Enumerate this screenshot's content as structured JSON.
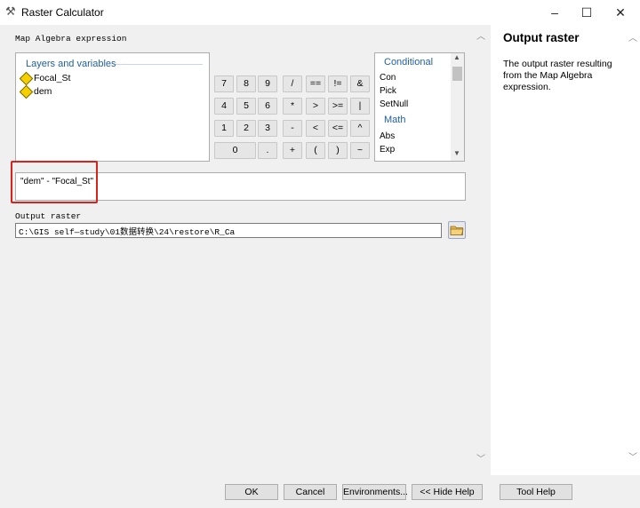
{
  "window": {
    "title": "Raster Calculator",
    "minimize_glyph": "–",
    "maximize_glyph": "☐",
    "close_glyph": "✕"
  },
  "expression_label": "Map Algebra expression",
  "layers": {
    "title": "Layers and variables",
    "items": [
      "Focal_St",
      "dem"
    ]
  },
  "keypad": {
    "rows": [
      [
        "7",
        "8",
        "9",
        "/",
        "==",
        "!=",
        "&"
      ],
      [
        "4",
        "5",
        "6",
        "*",
        ">",
        ">=",
        "|"
      ],
      [
        "1",
        "2",
        "3",
        "-",
        "<",
        "<=",
        "^"
      ],
      [
        "0",
        ".",
        "+",
        "(",
        ")",
        "~"
      ]
    ]
  },
  "functions": {
    "conditional_header": "Conditional",
    "conditional_items": [
      "Con",
      "Pick",
      "SetNull"
    ],
    "math_header": "Math",
    "math_items": [
      "Abs",
      "Exp"
    ]
  },
  "expression_value": "\"dem\" - \"Focal_St\"",
  "output": {
    "label": "Output raster",
    "value": "C:\\GIS  self—study\\01数据转换\\24\\restore\\R_Ca"
  },
  "help": {
    "title": "Output raster",
    "body": "The output raster resulting from the Map Algebra expression."
  },
  "footer": {
    "ok": "OK",
    "cancel": "Cancel",
    "environments": "Environments...",
    "hide_help": "<< Hide Help",
    "tool_help": "Tool Help"
  }
}
